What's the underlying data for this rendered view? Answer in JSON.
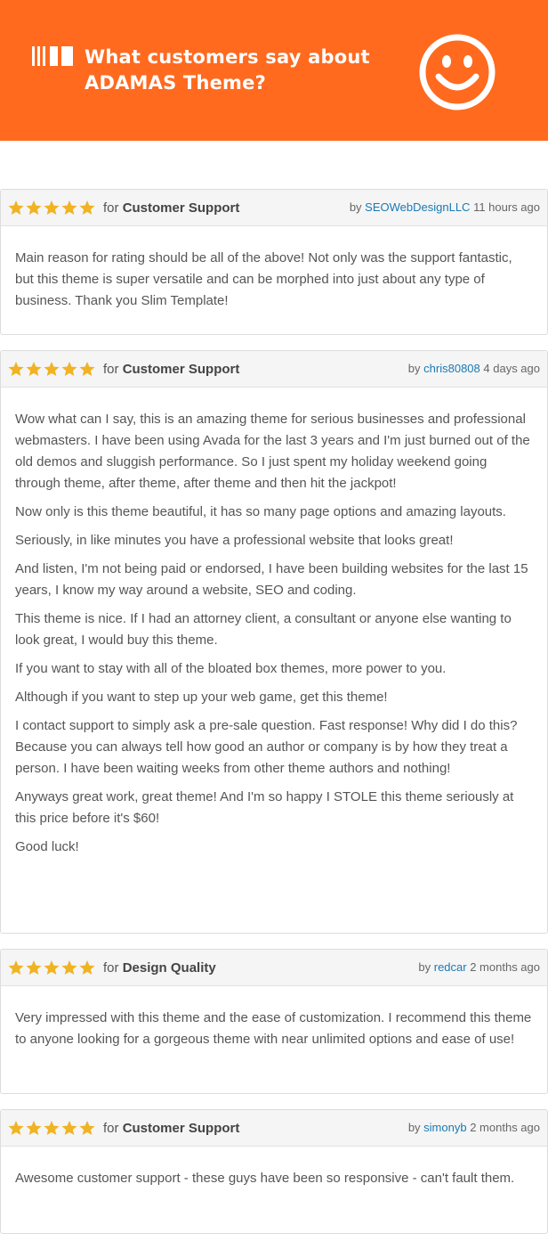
{
  "banner": {
    "title_line1": "What customers say about",
    "title_line2": "ADAMAS Theme?",
    "background": "#ff6a1f",
    "icons": [
      "bars-icon",
      "smiley-icon"
    ]
  },
  "colors": {
    "star": "#f0b323",
    "link": "#1a7ab4"
  },
  "reviews": [
    {
      "rating": 5,
      "for_prefix": "for",
      "category": "Customer Support",
      "by_prefix": "by",
      "user": "SEOWebDesignLLC",
      "time": "11 hours ago",
      "paragraphs": [
        "Main reason for rating should be all of the above! Not only was the support fantastic, but this theme is super versatile and can be morphed into just about any type of business. Thank you Slim Template!"
      ]
    },
    {
      "rating": 5,
      "for_prefix": "for",
      "category": "Customer Support",
      "by_prefix": "by",
      "user": "chris80808",
      "time": "4 days ago",
      "paragraphs": [
        "Wow what can I say, this is an amazing theme for serious businesses and professional webmasters. I have been using Avada for the last 3 years and I'm just burned out of the old demos and sluggish performance. So I just spent my holiday weekend going through theme, after theme, after theme and then hit the jackpot!",
        "Now only is this theme beautiful, it has so many page options and amazing layouts.",
        "Seriously, in like minutes you have a professional website that looks great!",
        "And listen, I'm not being paid or endorsed, I have been building websites for the last 15 years, I know my way around a website, SEO and coding.",
        "This theme is nice. If I had an attorney client, a consultant or anyone else wanting to look great, I would buy this theme.",
        "If you want to stay with all of the bloated box themes, more power to you.",
        "Although if you want to step up your web game, get this theme!",
        "I contact support to simply ask a pre-sale question. Fast response! Why did I do this? Because you can always tell how good an author or company is by how they treat a person. I have been waiting weeks from other theme authors and nothing!",
        "Anyways great work, great theme! And I'm so happy I STOLE this theme seriously at this price before it's $60!",
        "Good luck!"
      ]
    },
    {
      "rating": 5,
      "for_prefix": "for",
      "category": "Design Quality",
      "by_prefix": "by",
      "user": "redcar",
      "time": "2 months ago",
      "paragraphs": [
        "Very impressed with this theme and the ease of customization. I recommend this theme to anyone looking for a gorgeous theme with near unlimited options and ease of use!"
      ]
    },
    {
      "rating": 5,
      "for_prefix": "for",
      "category": "Customer Support",
      "by_prefix": "by",
      "user": "simonyb",
      "time": "2 months ago",
      "paragraphs": [
        "Awesome customer support - these guys have been so responsive - can't fault them."
      ]
    }
  ]
}
